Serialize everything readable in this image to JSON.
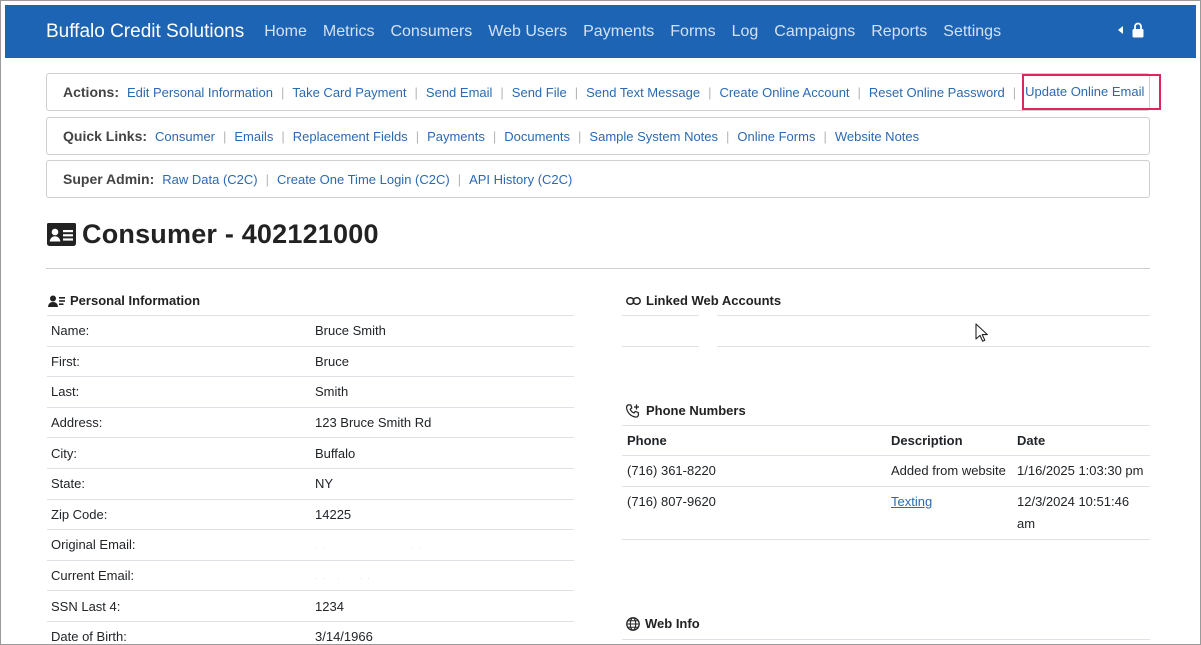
{
  "nav": {
    "brand": "Buffalo Credit Solutions",
    "items": [
      "Home",
      "Metrics",
      "Consumers",
      "Web Users",
      "Payments",
      "Forms",
      "Log",
      "Campaigns",
      "Reports",
      "Settings"
    ]
  },
  "actions": {
    "label": "Actions:",
    "links": [
      "Edit Personal Information",
      "Take Card Payment",
      "Send Email",
      "Send File",
      "Send Text Message",
      "Create Online Account",
      "Reset Online Password",
      "Update Online Email"
    ]
  },
  "quick_links": {
    "label": "Quick Links:",
    "links": [
      "Consumer",
      "Emails",
      "Replacement Fields",
      "Payments",
      "Documents",
      "Sample System Notes",
      "Online Forms",
      "Website Notes"
    ]
  },
  "super_admin": {
    "label": "Super Admin:",
    "links": [
      "Raw Data (C2C)",
      "Create One Time Login (C2C)",
      "API History (C2C)"
    ]
  },
  "page": {
    "title": "Consumer - 402121000"
  },
  "personal": {
    "heading": "Personal Information",
    "rows": [
      {
        "k": "Name:",
        "v": "Bruce Smith"
      },
      {
        "k": "First:",
        "v": "Bruce"
      },
      {
        "k": "Last:",
        "v": "Smith"
      },
      {
        "k": "Address:",
        "v": "123 Bruce Smith Rd"
      },
      {
        "k": "City:",
        "v": "Buffalo"
      },
      {
        "k": "State:",
        "v": "NY"
      },
      {
        "k": "Zip Code:",
        "v": "14225"
      },
      {
        "k": "Original Email:",
        "v": ""
      },
      {
        "k": "Current Email:",
        "v": ""
      },
      {
        "k": "SSN Last 4:",
        "v": "1234"
      },
      {
        "k": "Date of Birth:",
        "v": "3/14/1966"
      }
    ]
  },
  "linked": {
    "heading": "Linked Web Accounts"
  },
  "phones": {
    "heading": "Phone Numbers",
    "headers": [
      "Phone",
      "Description",
      "Date"
    ],
    "rows": [
      {
        "phone": "(716) 361-8220",
        "desc": "Added from website",
        "date": "1/16/2025 1:03:30 pm",
        "link": false
      },
      {
        "phone": "(716) 807-9620",
        "desc": "Texting",
        "date": "12/3/2024 10:51:46 am",
        "link": true
      }
    ]
  },
  "web_info": {
    "heading": "Web Info"
  }
}
